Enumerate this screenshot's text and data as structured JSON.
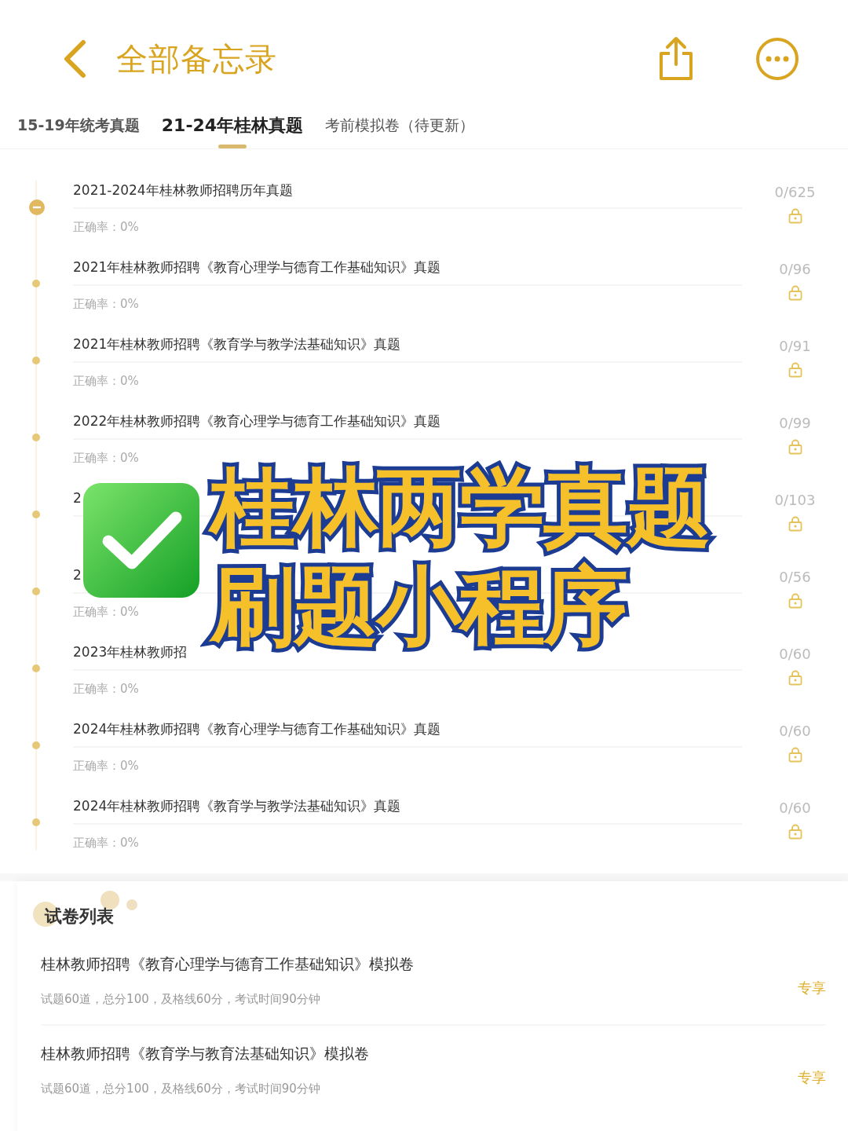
{
  "header": {
    "title": "全部备忘录"
  },
  "tabs": [
    {
      "label": "15-19年统考真题",
      "selected": false
    },
    {
      "label": "21-24年桂林真题",
      "selected": true
    },
    {
      "label": "考前模拟卷（待更新）",
      "selected": false
    }
  ],
  "rows": [
    {
      "title": "2021-2024年桂林教师招聘历年真题",
      "accuracy": "正确率：0%",
      "count": "0/625",
      "expanded": true
    },
    {
      "title": "2021年桂林教师招聘《教育心理学与德育工作基础知识》真题",
      "accuracy": "正确率：0%",
      "count": "0/96",
      "expanded": false
    },
    {
      "title": "2021年桂林教师招聘《教育学与教学法基础知识》真题",
      "accuracy": "正确率：0%",
      "count": "0/91",
      "expanded": false
    },
    {
      "title": "2022年桂林教师招聘《教育心理学与德育工作基础知识》真题",
      "accuracy": "正确率：0%",
      "count": "0/99",
      "expanded": false
    },
    {
      "title": "2",
      "count": "0/103",
      "expanded": false
    },
    {
      "title": "2",
      "accuracy": "正确率：0%",
      "count": "0/56",
      "expanded": false
    },
    {
      "title": "2023年桂林教师招",
      "accuracy": "正确率：0%",
      "count": "0/60",
      "expanded": false
    },
    {
      "title": "2024年桂林教师招聘《教育心理学与德育工作基础知识》真题",
      "accuracy": "正确率：0%",
      "count": "0/60",
      "expanded": false
    },
    {
      "title": "2024年桂林教师招聘《教育学与教学法基础知识》真题",
      "accuracy": "正确率：0%",
      "count": "0/60",
      "expanded": false
    }
  ],
  "papers": {
    "heading": "试卷列表",
    "items": [
      {
        "title": "桂林教师招聘《教育心理学与德育工作基础知识》模拟卷",
        "info": "试题60道，总分100，及格线60分，考试时间90分钟",
        "badge": "专享"
      },
      {
        "title": "桂林教师招聘《教育学与教育法基础知识》模拟卷",
        "info": "试题60道，总分100，及格线60分，考试时间90分钟",
        "badge": "专享"
      }
    ]
  },
  "overlay": {
    "lines": [
      "桂林两学真题",
      "刷题小程序"
    ]
  }
}
